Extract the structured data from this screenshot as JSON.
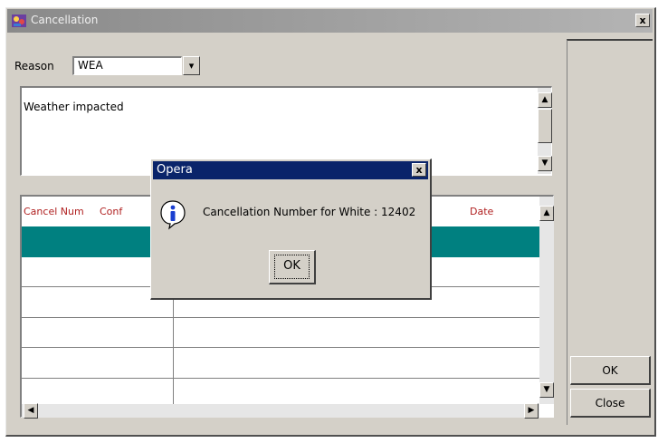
{
  "window": {
    "title": "Cancellation",
    "close_glyph": "x"
  },
  "form": {
    "reason_label": "Reason",
    "reason_value": "WEA",
    "dropdown_glyph": "▾",
    "description_text": "Weather impacted"
  },
  "table": {
    "columns": [
      "Cancel Num",
      "Conf",
      "Date"
    ],
    "selected_row_color": "#008080"
  },
  "scroll": {
    "up_glyph": "▲",
    "down_glyph": "▼",
    "left_glyph": "◀",
    "right_glyph": "▶"
  },
  "dialog": {
    "title": "Opera",
    "close_glyph": "x",
    "message": "Cancellation Number for White : 12402",
    "ok_label": "OK",
    "icon": "info-icon"
  },
  "side": {
    "ok_label": "OK",
    "close_label": "Close"
  }
}
